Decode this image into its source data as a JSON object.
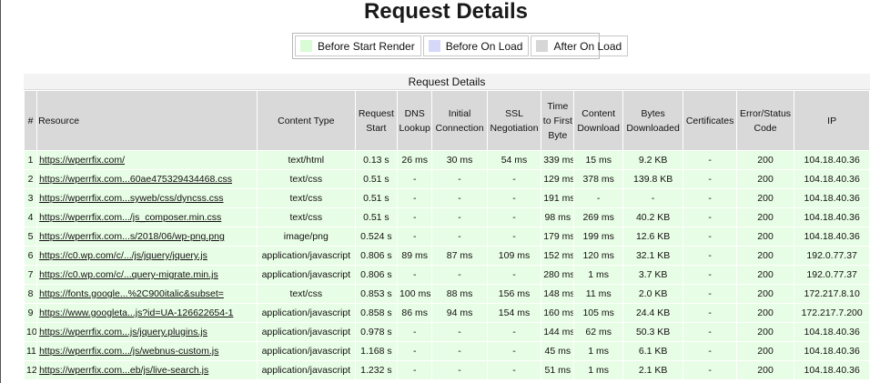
{
  "page_title": "Request Details",
  "legend": [
    {
      "label": "Before Start Render",
      "color": "#d9fbd5"
    },
    {
      "label": "Before On Load",
      "color": "#d6d8fa"
    },
    {
      "label": "After On Load",
      "color": "#d6d6d6"
    }
  ],
  "table": {
    "caption": "Request Details",
    "headers": {
      "num": "#",
      "resource": "Resource",
      "content_type": "Content Type",
      "request_start": "Request Start",
      "dns": "DNS Lookup",
      "connect": "Initial Connection",
      "ssl": "SSL Negotiation",
      "ttfb": "Time to First Byte",
      "download": "Content Download",
      "bytes": "Bytes Downloaded",
      "certs": "Certificates",
      "status": "Error/Status Code",
      "ip": "IP"
    },
    "rows": [
      {
        "num": "1",
        "resource": "https://wperrfix.com/",
        "type": "text/html",
        "start": "0.13 s",
        "dns": "26 ms",
        "connect": "30 ms",
        "ssl": "54 ms",
        "ttfb": "339 ms",
        "download": "15 ms",
        "bytes": "9.2 KB",
        "certs": "-",
        "status": "200",
        "ip": "104.18.40.36"
      },
      {
        "num": "2",
        "resource": "https://wperrfix.com...60ae475329434468.css",
        "type": "text/css",
        "start": "0.51 s",
        "dns": "-",
        "connect": "-",
        "ssl": "-",
        "ttfb": "129 ms",
        "download": "378 ms",
        "bytes": "139.8 KB",
        "certs": "-",
        "status": "200",
        "ip": "104.18.40.36"
      },
      {
        "num": "3",
        "resource": "https://wperrfix.com...syweb/css/dyncss.css",
        "type": "text/css",
        "start": "0.51 s",
        "dns": "-",
        "connect": "-",
        "ssl": "-",
        "ttfb": "191 ms",
        "download": "-",
        "bytes": "-",
        "certs": "-",
        "status": "200",
        "ip": "104.18.40.36"
      },
      {
        "num": "4",
        "resource": "https://wperrfix.com.../js_composer.min.css",
        "type": "text/css",
        "start": "0.51 s",
        "dns": "-",
        "connect": "-",
        "ssl": "-",
        "ttfb": "98 ms",
        "download": "269 ms",
        "bytes": "40.2 KB",
        "certs": "-",
        "status": "200",
        "ip": "104.18.40.36"
      },
      {
        "num": "5",
        "resource": "https://wperrfix.com...s/2018/06/wp-png.png",
        "type": "image/png",
        "start": "0.524 s",
        "dns": "-",
        "connect": "-",
        "ssl": "-",
        "ttfb": "179 ms",
        "download": "199 ms",
        "bytes": "12.6 KB",
        "certs": "-",
        "status": "200",
        "ip": "104.18.40.36"
      },
      {
        "num": "6",
        "resource": "https://c0.wp.com/c/.../js/jquery/jquery.js",
        "type": "application/javascript",
        "start": "0.806 s",
        "dns": "89 ms",
        "connect": "87 ms",
        "ssl": "109 ms",
        "ttfb": "152 ms",
        "download": "120 ms",
        "bytes": "32.1 KB",
        "certs": "-",
        "status": "200",
        "ip": "192.0.77.37"
      },
      {
        "num": "7",
        "resource": "https://c0.wp.com/c/...query-migrate.min.js",
        "type": "application/javascript",
        "start": "0.806 s",
        "dns": "-",
        "connect": "-",
        "ssl": "-",
        "ttfb": "280 ms",
        "download": "1 ms",
        "bytes": "3.7 KB",
        "certs": "-",
        "status": "200",
        "ip": "192.0.77.37"
      },
      {
        "num": "8",
        "resource": "https://fonts.google...%2C900italic&subset=",
        "type": "text/css",
        "start": "0.853 s",
        "dns": "100 ms",
        "connect": "88 ms",
        "ssl": "156 ms",
        "ttfb": "148 ms",
        "download": "11 ms",
        "bytes": "2.0 KB",
        "certs": "-",
        "status": "200",
        "ip": "172.217.8.10"
      },
      {
        "num": "9",
        "resource": "https://www.googleta...js?id=UA-126622654-1",
        "type": "application/javascript",
        "start": "0.858 s",
        "dns": "86 ms",
        "connect": "94 ms",
        "ssl": "154 ms",
        "ttfb": "160 ms",
        "download": "105 ms",
        "bytes": "24.4 KB",
        "certs": "-",
        "status": "200",
        "ip": "172.217.7.200"
      },
      {
        "num": "10",
        "resource": "https://wperrfix.com...js/jquery.plugins.js",
        "type": "application/javascript",
        "start": "0.978 s",
        "dns": "-",
        "connect": "-",
        "ssl": "-",
        "ttfb": "144 ms",
        "download": "62 ms",
        "bytes": "50.3 KB",
        "certs": "-",
        "status": "200",
        "ip": "104.18.40.36"
      },
      {
        "num": "11",
        "resource": "https://wperrfix.com.../js/webnus-custom.js",
        "type": "application/javascript",
        "start": "1.168 s",
        "dns": "-",
        "connect": "-",
        "ssl": "-",
        "ttfb": "45 ms",
        "download": "1 ms",
        "bytes": "6.1 KB",
        "certs": "-",
        "status": "200",
        "ip": "104.18.40.36"
      },
      {
        "num": "12",
        "resource": "https://wperrfix.com...eb/js/live-search.js",
        "type": "application/javascript",
        "start": "1.232 s",
        "dns": "-",
        "connect": "-",
        "ssl": "-",
        "ttfb": "51 ms",
        "download": "1 ms",
        "bytes": "2.1 KB",
        "certs": "-",
        "status": "200",
        "ip": "104.18.40.36"
      }
    ]
  }
}
